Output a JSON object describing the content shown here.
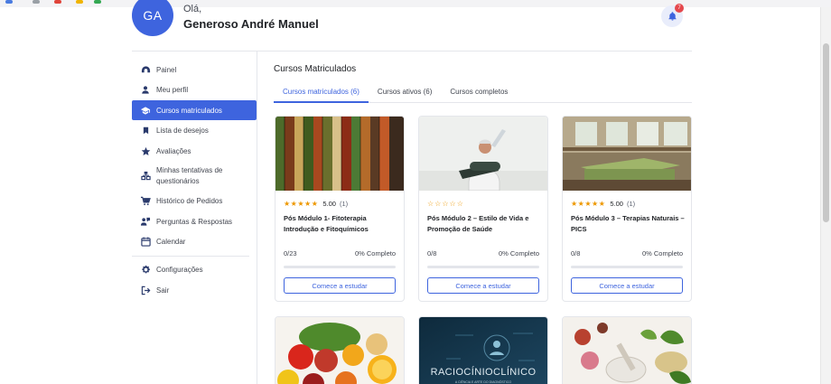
{
  "header": {
    "avatar_initials": "GA",
    "greeting": "Olá,",
    "user_name": "Generoso André Manuel",
    "notification_count": "7"
  },
  "sidebar": {
    "items": [
      {
        "label": "Painel",
        "icon": "dashboard-icon"
      },
      {
        "label": "Meu perfil",
        "icon": "user-icon"
      },
      {
        "label": "Cursos matriculados",
        "icon": "graduation-cap-icon",
        "active": true
      },
      {
        "label": "Lista de desejos",
        "icon": "bookmark-icon"
      },
      {
        "label": "Avaliações",
        "icon": "star-icon"
      },
      {
        "label": "Minhas tentativas de questionários",
        "icon": "quiz-icon"
      },
      {
        "label": "Histórico de Pedidos",
        "icon": "cart-icon"
      },
      {
        "label": "Perguntas & Respostas",
        "icon": "qa-icon"
      },
      {
        "label": "Calendar",
        "icon": "calendar-icon"
      }
    ],
    "bottom_items": [
      {
        "label": "Configurações",
        "icon": "gear-icon"
      },
      {
        "label": "Sair",
        "icon": "logout-icon"
      }
    ]
  },
  "main": {
    "title": "Cursos Matriculados",
    "tabs": [
      {
        "label": "Cursos matriculados (6)",
        "active": true
      },
      {
        "label": "Cursos ativos (6)"
      },
      {
        "label": "Cursos completos"
      }
    ],
    "courses": [
      {
        "rating": "5.00",
        "rating_count": "(1)",
        "stars": 5,
        "title": "Pós Módulo 1- Fitoterapia Introdução e Fitoquímicos",
        "progress_text": "0/23",
        "completion": "0% Completo",
        "progress": 0,
        "button": "Comece a estudar"
      },
      {
        "rating": "",
        "rating_count": "",
        "stars": 0,
        "title": "Pós Módulo 2 – Estilo de Vida e Promoção de Saúde",
        "progress_text": "0/8",
        "completion": "0% Completo",
        "progress": 0,
        "button": "Comece a estudar"
      },
      {
        "rating": "5.00",
        "rating_count": "(1)",
        "stars": 5,
        "title": "Pós Módulo 3 – Terapias Naturais – PICS",
        "progress_text": "0/8",
        "completion": "0% Completo",
        "progress": 0,
        "button": "Comece a estudar"
      }
    ],
    "lower_courses": [
      {
        "image": "fruits-vegetables"
      },
      {
        "image": "clinical-reasoning",
        "caption": "RACIOCÍNIOCLÍNICO",
        "subcaption": "A CIÊNCIA E ARTE DO DIAGNÓSTICO"
      },
      {
        "image": "herbs-mortar"
      }
    ]
  },
  "colors": {
    "accent": "#3e64de",
    "star": "#ed9700",
    "badge": "#e5484d"
  }
}
